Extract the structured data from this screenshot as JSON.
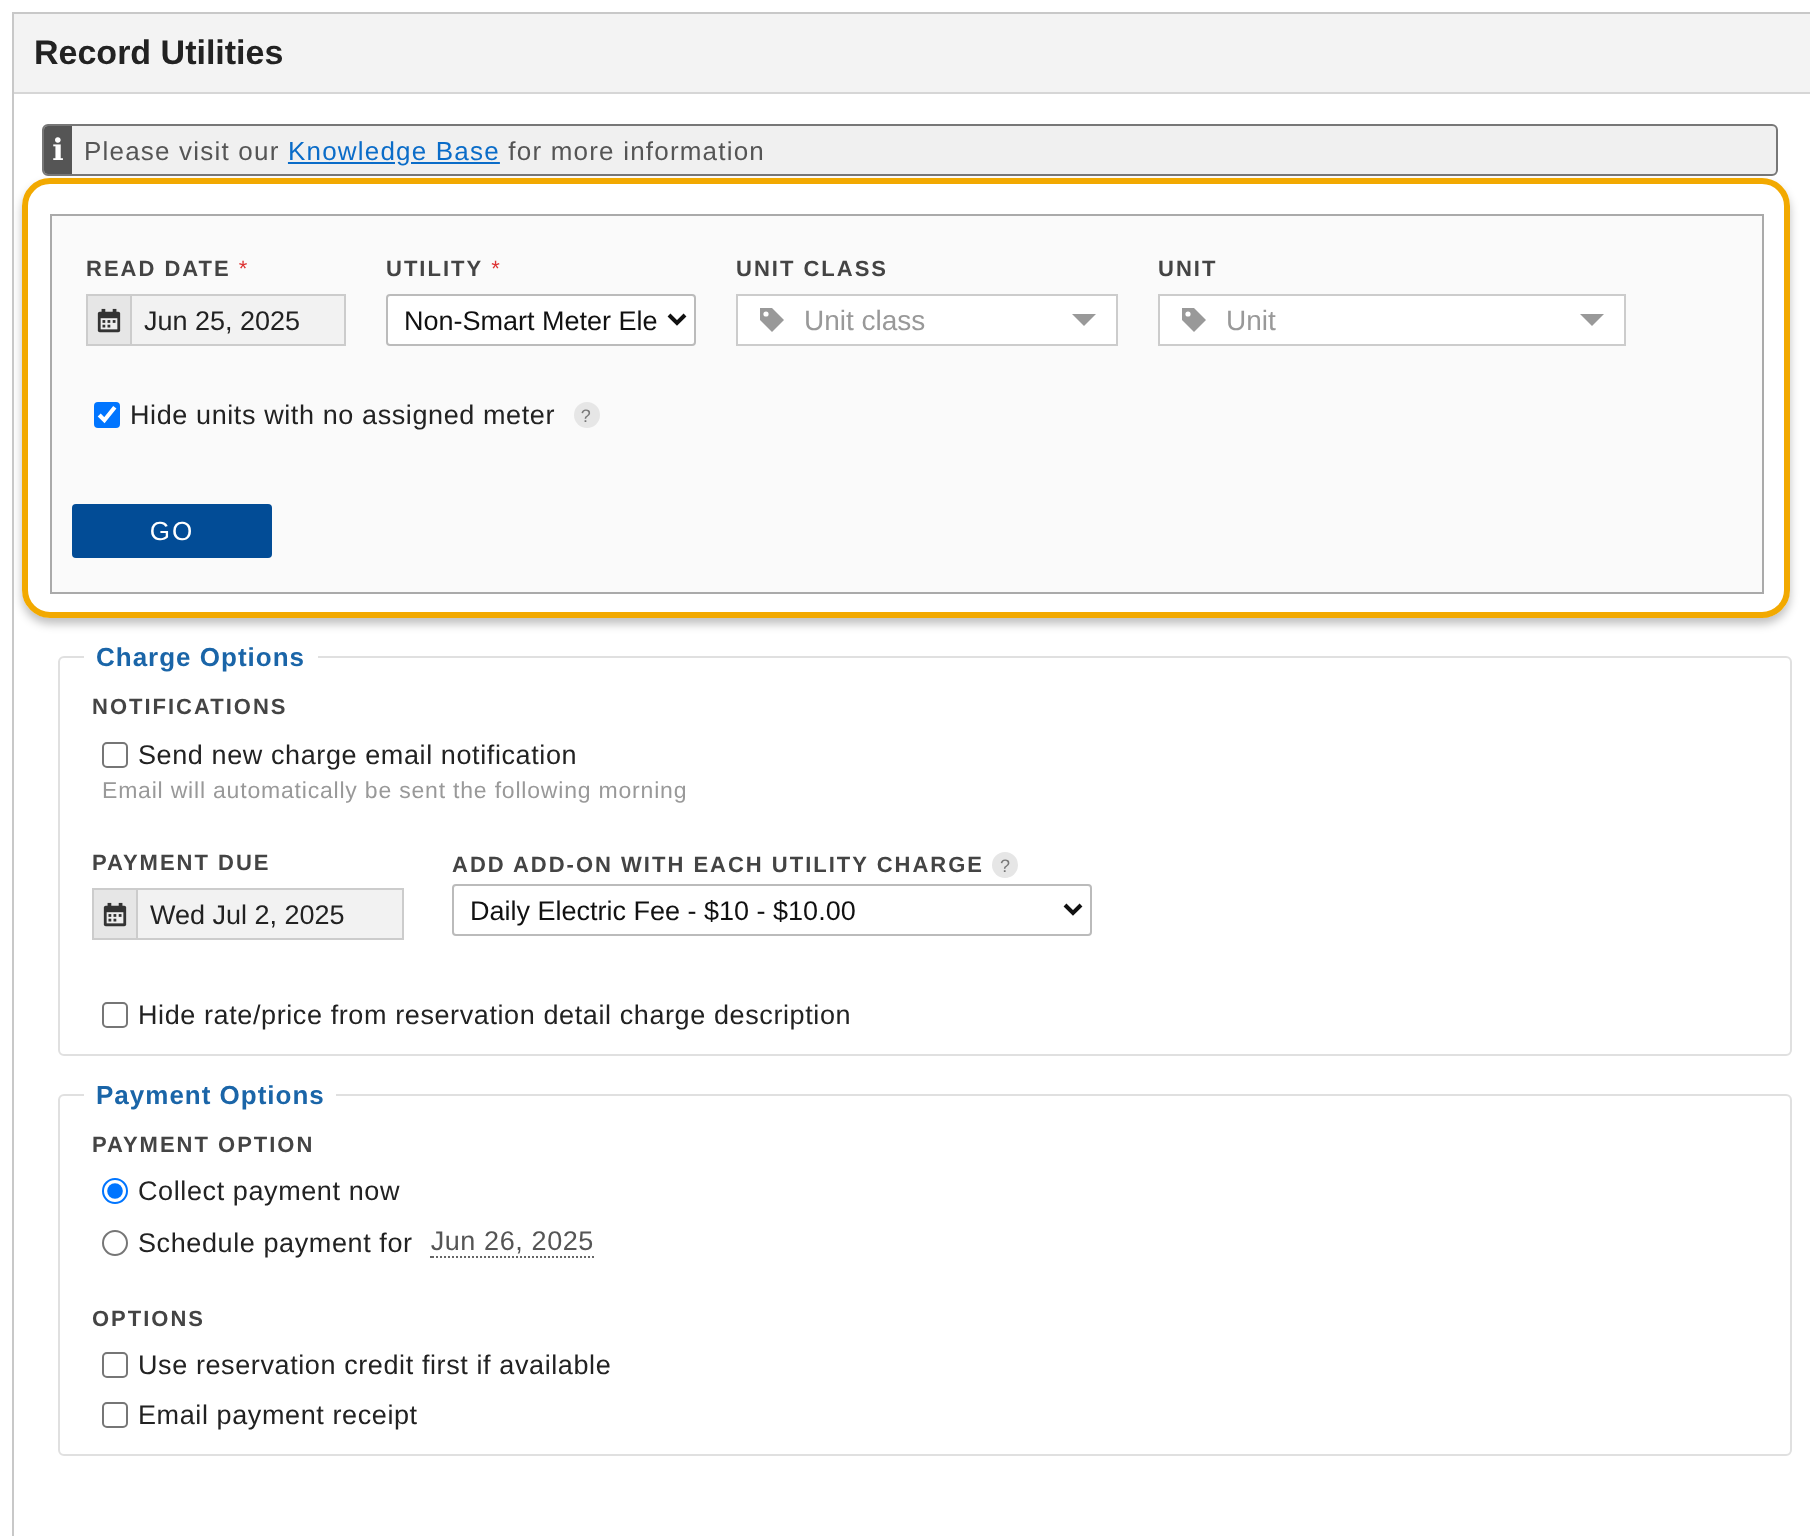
{
  "title": "Record Utilities",
  "info": {
    "icon": "i",
    "before": "Please visit our",
    "link": "Knowledge Base",
    "after": "for more information"
  },
  "filters": {
    "highlighted": true,
    "fields": [
      {
        "kind": "date",
        "label": "READ DATE",
        "required_mark": "*",
        "value": "Jun 25, 2025"
      },
      {
        "kind": "select",
        "label": "UTILITY",
        "required_mark": "*",
        "value": "Non-Smart Meter Ele"
      },
      {
        "kind": "tagselect",
        "label": "UNIT CLASS",
        "placeholder": "Unit class"
      },
      {
        "kind": "tagselect",
        "label": "UNIT",
        "placeholder": "Unit"
      }
    ],
    "hide_units": {
      "label": "Hide units with no assigned meter",
      "checked": true,
      "help": "?"
    },
    "go_button": "GO"
  },
  "charge_options": {
    "legend": "Charge Options",
    "notifications_label": "NOTIFICATIONS",
    "send_email": {
      "label": "Send new charge email notification",
      "checked": false
    },
    "hint": "Email will automatically be sent the following morning",
    "payment_due": {
      "label": "PAYMENT DUE",
      "value": "Wed Jul 2, 2025"
    },
    "addon": {
      "label": "ADD ADD-ON WITH EACH UTILITY CHARGE",
      "help": "?",
      "value": "Daily Electric Fee - $10 - $10.00"
    },
    "hide_rate": {
      "label": "Hide rate/price from reservation detail charge description",
      "checked": false
    }
  },
  "payment_options": {
    "legend": "Payment Options",
    "payment_option_label": "PAYMENT OPTION",
    "radios": [
      {
        "label": "Collect payment now",
        "selected": true
      },
      {
        "label": "Schedule payment for",
        "date": "Jun 26, 2025",
        "selected": false
      }
    ],
    "options_label": "OPTIONS",
    "checkboxes": [
      {
        "label": "Use reservation credit first if available",
        "checked": false
      },
      {
        "label": "Email payment receipt",
        "checked": false
      }
    ]
  }
}
